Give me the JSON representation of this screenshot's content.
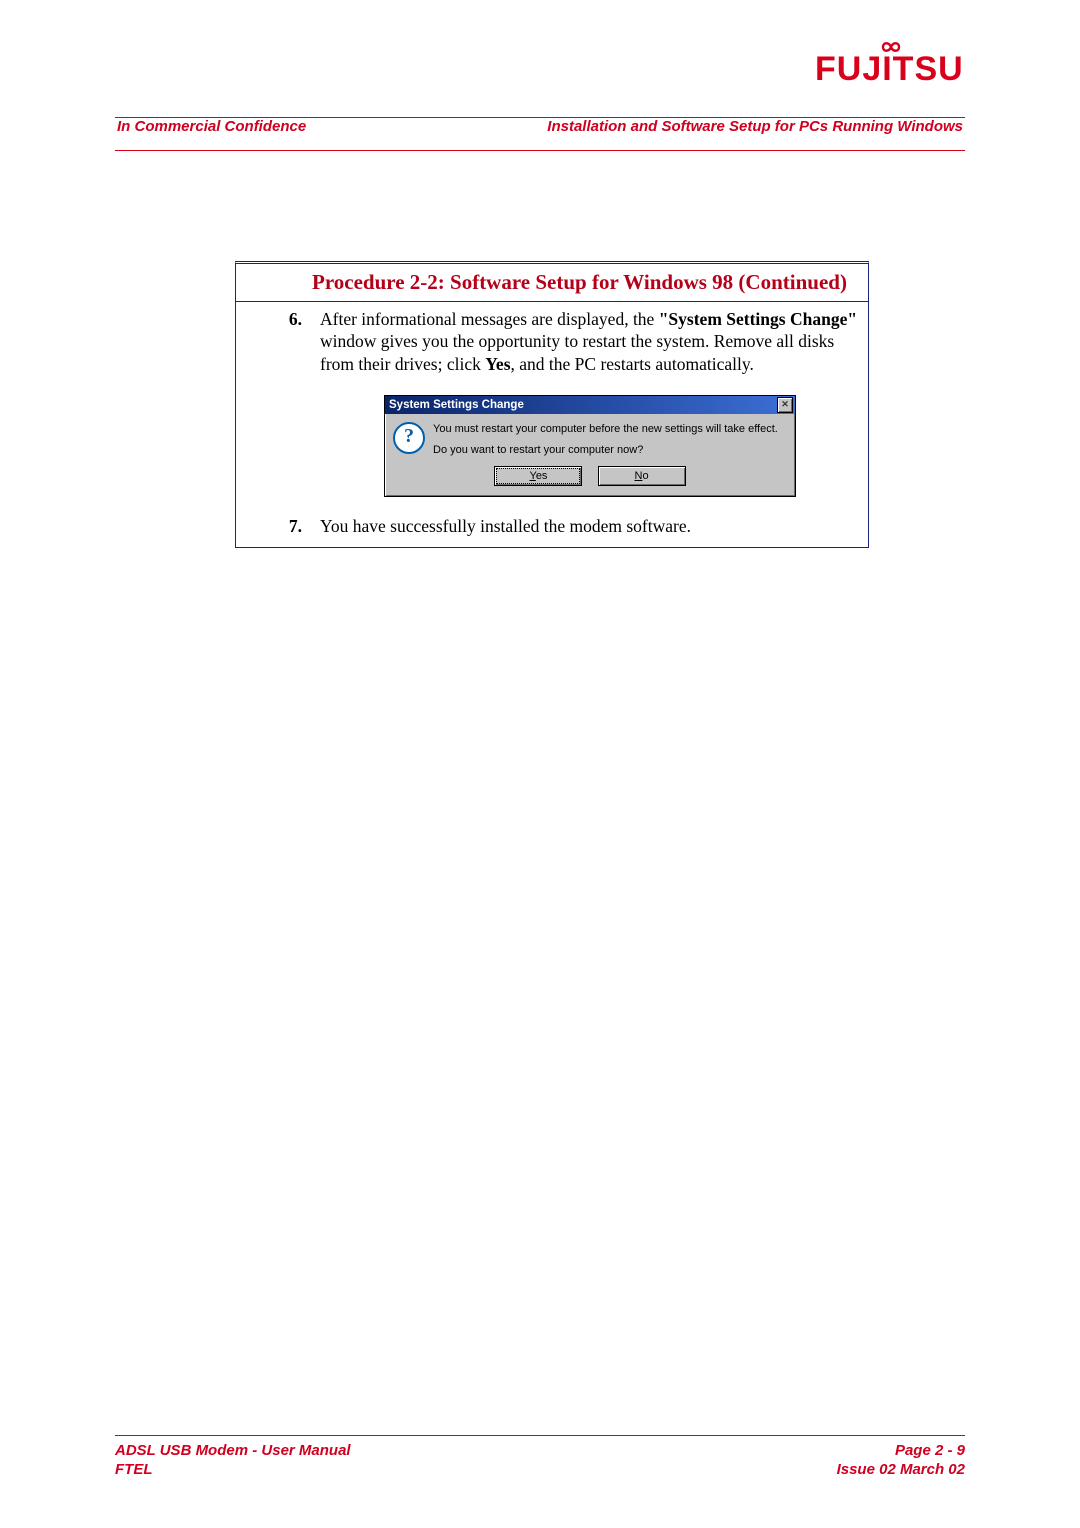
{
  "brand": {
    "name": "FUJITSU"
  },
  "header": {
    "left": "In Commercial Confidence",
    "right": "Installation and Software Setup for PCs Running Windows"
  },
  "procedure": {
    "title": "Procedure 2-2: Software Setup for Windows 98 (Continued)",
    "steps": [
      {
        "num": "6.",
        "pre": "After informational messages are displayed, the ",
        "bold1": "\"System Settings Change\"",
        "mid": " window gives you the opportunity to restart the system. Remove all disks from their drives; click ",
        "bold2": "Yes",
        "post": ", and the PC restarts automatically."
      },
      {
        "num": "7.",
        "text": "You have successfully installed the modem software."
      }
    ]
  },
  "dialog": {
    "title": "System Settings Change",
    "close_glyph": "✕",
    "icon_glyph": "?",
    "line1": "You must restart your computer before the new settings will take effect.",
    "line2": "Do you want to restart your computer now?",
    "yes": "Yes",
    "no": "No"
  },
  "footer": {
    "left1": "ADSL USB Modem - User Manual",
    "left2": "FTEL",
    "right1": "Page 2 - 9",
    "right2": "Issue 02 March 02"
  }
}
